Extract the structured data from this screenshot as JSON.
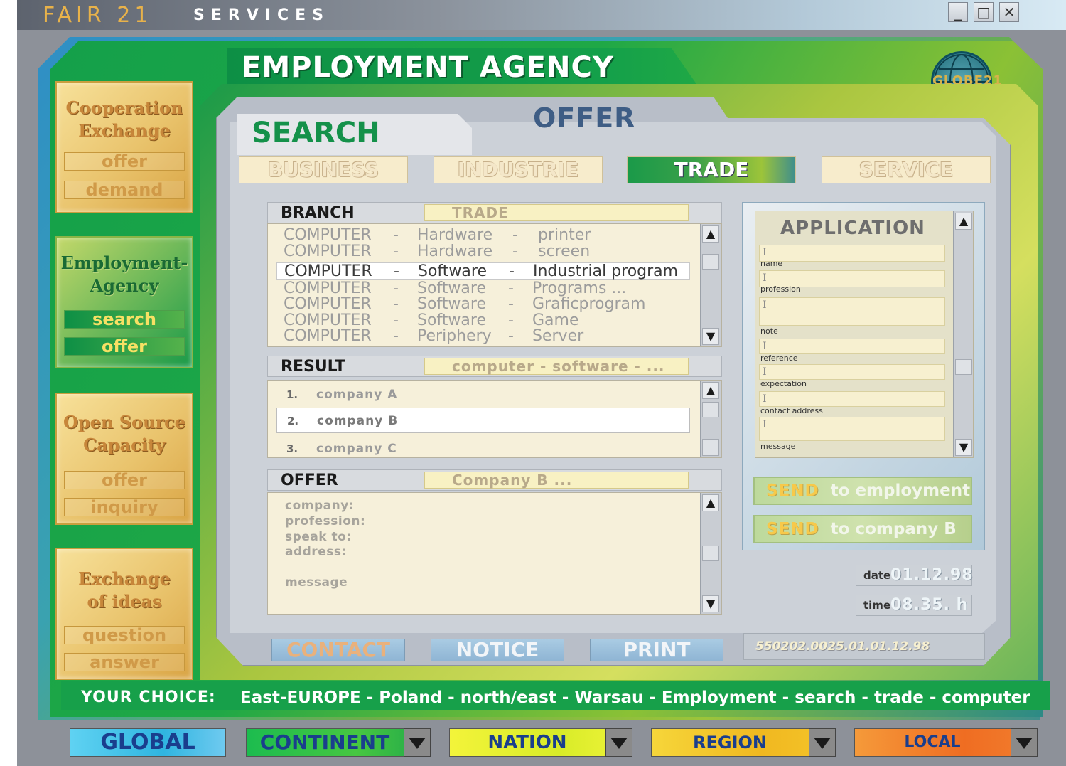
{
  "window": {
    "brand": "FAIR 21",
    "brand_sub": "SERVICES",
    "minimize": "_",
    "maximize": "□",
    "close": "✕"
  },
  "header": {
    "title": "EMPLOYMENT AGENCY",
    "logo_text": "GLOBE21"
  },
  "sidebar": {
    "groups": [
      {
        "title_line1": "Cooperation",
        "title_line2": "Exchange",
        "links": [
          "offer",
          "demand"
        ]
      },
      {
        "title_line1": "Employment-",
        "title_line2": "Agency",
        "links": [
          "search",
          "offer"
        ]
      },
      {
        "title_line1": "Open Source",
        "title_line2": "Capacity",
        "links": [
          "offer",
          "inquiry"
        ]
      },
      {
        "title_line1": "Exchange",
        "title_line2": "of ideas",
        "links": [
          "question",
          "answer"
        ]
      }
    ]
  },
  "main": {
    "search_label": "SEARCH",
    "offer_label": "OFFER",
    "categories": [
      "BUSINESS",
      "INDUSTRIE",
      "TRADE",
      "SERVICE"
    ],
    "active_category": "TRADE",
    "branch": {
      "label": "BRANCH",
      "value": "TRADE",
      "rows": [
        [
          "COMPUTER",
          "-",
          "Hardware",
          "-",
          "printer"
        ],
        [
          "COMPUTER",
          "-",
          "Hardware",
          "-",
          "screen"
        ],
        [
          "COMPUTER",
          "-",
          "Software",
          "-",
          "Industrial program"
        ],
        [
          "COMPUTER",
          "-",
          "Software",
          "-",
          "Programs ..."
        ],
        [
          "COMPUTER",
          "-",
          "Software",
          "-",
          "Graficprogram"
        ],
        [
          "COMPUTER",
          "-",
          "Software",
          "-",
          "Game"
        ],
        [
          "COMPUTER",
          "-",
          "Periphery",
          "-",
          "Server"
        ]
      ],
      "selected_index": 2
    },
    "result": {
      "label": "RESULT",
      "value": "computer  -  software  -  ...",
      "rows": [
        {
          "num": "1.",
          "text": "company  A"
        },
        {
          "num": "2.",
          "text": "company  B"
        },
        {
          "num": "3.",
          "text": "company  C"
        }
      ],
      "selected_index": 1
    },
    "offer": {
      "label": "OFFER",
      "value": "Company B ...",
      "lines": [
        "company:",
        "profession:",
        "speak to:",
        "address:",
        "message"
      ]
    },
    "footer_buttons": [
      "CONTACT",
      "NOTICE",
      "PRINT"
    ],
    "serial": "550202.0025.01.01.12.98"
  },
  "application": {
    "title": "APPLICATION",
    "caret": "I",
    "fields": [
      "name",
      "profession",
      "note",
      "reference",
      "expectation",
      "contact address",
      "message"
    ],
    "send_employment": {
      "send": "SEND",
      "to": "to employment"
    },
    "send_company": {
      "send": "SEND",
      "to": "to company B"
    }
  },
  "datetime": {
    "date_label": "date",
    "date_value": "01.12.98",
    "time_label": "time",
    "time_value": "08.35. h"
  },
  "choice": {
    "label": "YOUR CHOICE:",
    "value": "East-EUROPE - Poland - north/east - Warsau - Employment - search - trade - computer"
  },
  "levels": [
    "GLOBAL",
    "CONTINENT",
    "NATION",
    "REGION",
    "LOCAL"
  ],
  "colors": {
    "brand": "#e8b24a",
    "accent_green": "#1a9a49",
    "side_gold": "#e9c36c",
    "global": "#4fc8ea",
    "continent": "#19b24a",
    "nation": "#e8ef2c",
    "region": "#f5c52a",
    "local": "#ef7a2a"
  }
}
